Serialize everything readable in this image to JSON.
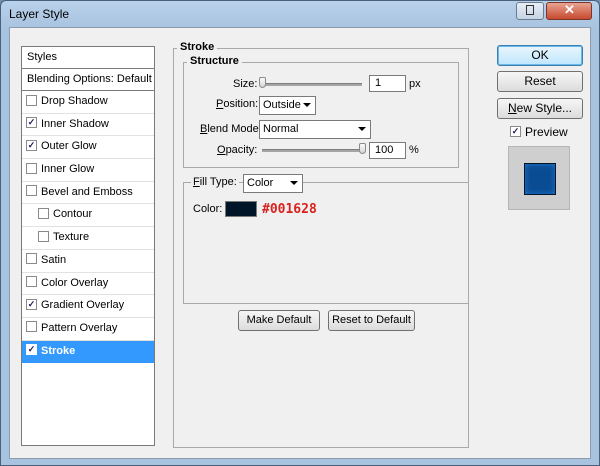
{
  "window": {
    "title": "Layer Style"
  },
  "styles_panel": {
    "header": "Styles",
    "blending": "Blending Options: Default",
    "items": [
      {
        "label": "Drop Shadow",
        "checked": false,
        "indent": false,
        "selected": false
      },
      {
        "label": "Inner Shadow",
        "checked": true,
        "indent": false,
        "selected": false
      },
      {
        "label": "Outer Glow",
        "checked": true,
        "indent": false,
        "selected": false
      },
      {
        "label": "Inner Glow",
        "checked": false,
        "indent": false,
        "selected": false
      },
      {
        "label": "Bevel and Emboss",
        "checked": false,
        "indent": false,
        "selected": false
      },
      {
        "label": "Contour",
        "checked": false,
        "indent": true,
        "selected": false
      },
      {
        "label": "Texture",
        "checked": false,
        "indent": true,
        "selected": false
      },
      {
        "label": "Satin",
        "checked": false,
        "indent": false,
        "selected": false
      },
      {
        "label": "Color Overlay",
        "checked": false,
        "indent": false,
        "selected": false
      },
      {
        "label": "Gradient Overlay",
        "checked": true,
        "indent": false,
        "selected": false
      },
      {
        "label": "Pattern Overlay",
        "checked": false,
        "indent": false,
        "selected": false
      },
      {
        "label": "Stroke",
        "checked": true,
        "indent": false,
        "selected": true
      }
    ]
  },
  "stroke": {
    "group_title": "Stroke",
    "structure_title": "Structure",
    "size_label": "Size:",
    "size_value": "1",
    "size_unit": "px",
    "size_slider_fraction": 0.0,
    "position_label": "Position:",
    "position_value": "Outside",
    "blend_label": "Blend Mode:",
    "blend_value": "Normal",
    "opacity_label": "Opacity:",
    "opacity_value": "100",
    "opacity_unit": "%",
    "opacity_slider_fraction": 1.0,
    "fill_type_label": "Fill Type:",
    "fill_type_value": "Color",
    "color_label": "Color:",
    "color_value": "#001628",
    "make_default": "Make Default",
    "reset_default": "Reset to Default"
  },
  "buttons": {
    "ok": "OK",
    "reset": "Reset",
    "new_style": "New Style...",
    "preview_label": "Preview",
    "preview_checked": true
  },
  "colors": {
    "selection": "#3399ff",
    "stroke_color": "#001628",
    "hex_annotation": "#d8221e",
    "preview_fill": "#0a4c93"
  }
}
